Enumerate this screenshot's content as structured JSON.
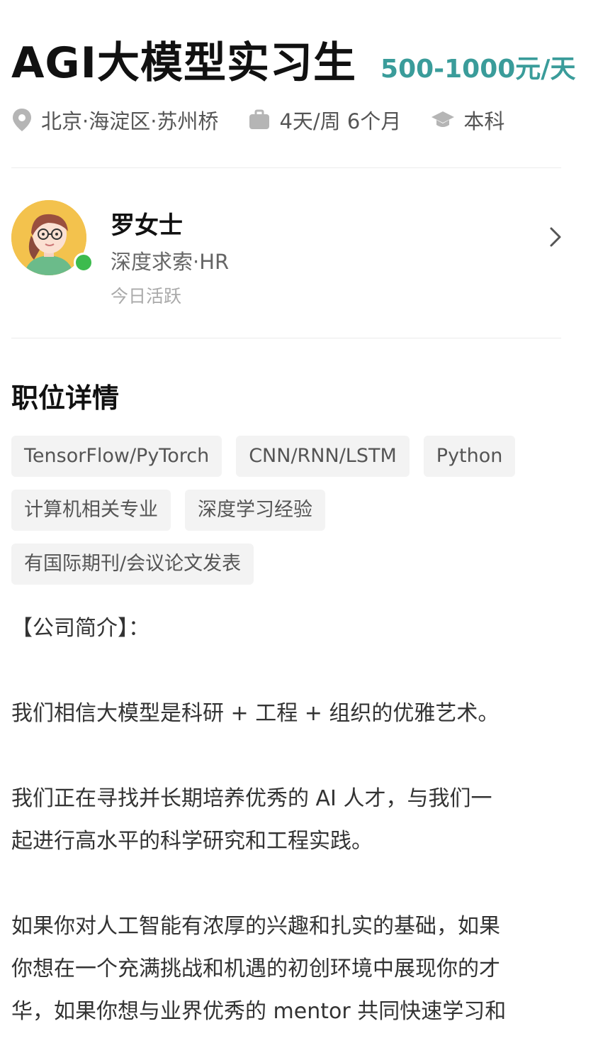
{
  "job": {
    "title": "AGI大模型实习生",
    "salary": "500-1000元/天",
    "location": "北京·海淀区·苏州桥",
    "schedule": "4天/周 6个月",
    "education": "本科"
  },
  "hr": {
    "name": "罗女士",
    "company_role": "深度求索·HR",
    "status": "今日活跃"
  },
  "section_title": "职位详情",
  "tags": [
    [
      "TensorFlow/PyTorch",
      "CNN/RNN/LSTM",
      "Python"
    ],
    [
      "计算机相关专业",
      "深度学习经验"
    ],
    [
      "有国际期刊/会议论文发表"
    ]
  ],
  "description": {
    "heading": "【公司简介】：",
    "p1_line1": "我们相信大模型是科研 + 工程 + 组织的优雅艺术。",
    "p2_line1": "我们正在寻找并长期培养优秀的 AI 人才，与我们一",
    "p2_line2": "起进行高水平的科学研究和工程实践。",
    "p3_line1": "如果你对人工智能有浓厚的兴趣和扎实的基础，如果",
    "p3_line2": "你想在一个充满挑战和机遇的初创环境中展现你的才",
    "p3_line3": "华，如果你想与业界优秀的 mentor 共同快速学习和"
  },
  "icons": {
    "location": "location-pin-icon",
    "schedule": "briefcase-icon",
    "education": "graduation-cap-icon",
    "chevron": "chevron-right-icon"
  },
  "colors": {
    "salary": "#3a9c9a",
    "online": "#3dbb4e",
    "avatar_bg": "#f3c24d"
  }
}
